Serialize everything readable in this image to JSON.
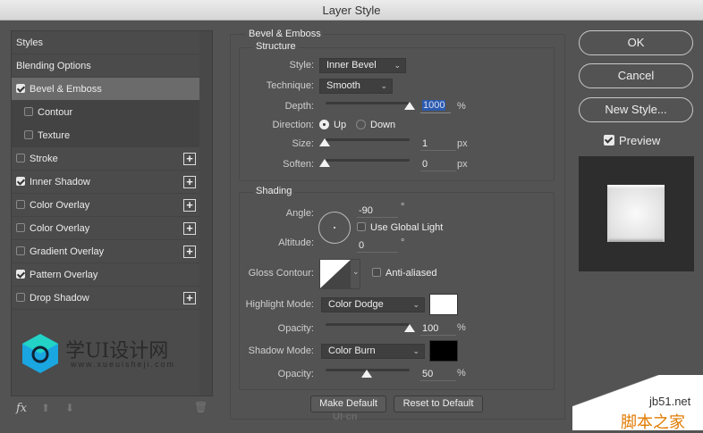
{
  "window": {
    "title": "Layer Style"
  },
  "sidebar": {
    "items": [
      {
        "label": "Styles",
        "checkbox": null
      },
      {
        "label": "Blending Options",
        "checkbox": null
      },
      {
        "label": "Bevel & Emboss",
        "checked": true,
        "selected": true
      },
      {
        "label": "Contour",
        "checked": false
      },
      {
        "label": "Texture",
        "checked": false
      },
      {
        "label": "Stroke",
        "checked": false,
        "plus": true
      },
      {
        "label": "Inner Shadow",
        "checked": true,
        "plus": true
      },
      {
        "label": "Color Overlay",
        "checked": false,
        "plus": true
      },
      {
        "label": "Color Overlay",
        "checked": false,
        "plus": true
      },
      {
        "label": "Gradient Overlay",
        "checked": false,
        "plus": true
      },
      {
        "label": "Pattern Overlay",
        "checked": true
      },
      {
        "label": "Drop Shadow",
        "checked": false,
        "plus": true
      }
    ],
    "fx_label": "fx",
    "watermark": {
      "title": "学UI设计网",
      "url": "www.xueuisheji.com"
    }
  },
  "panel": {
    "section_title": "Bevel & Emboss",
    "structure": {
      "title": "Structure",
      "style_label": "Style:",
      "style_value": "Inner Bevel",
      "technique_label": "Technique:",
      "technique_value": "Smooth",
      "depth_label": "Depth:",
      "depth_value": "1000",
      "depth_unit": "%",
      "depth_slider": 1.0,
      "direction_label": "Direction:",
      "direction_up": "Up",
      "direction_down": "Down",
      "direction_selected": "Up",
      "size_label": "Size:",
      "size_value": "1",
      "size_unit": "px",
      "size_slider": 0.0,
      "soften_label": "Soften:",
      "soften_value": "0",
      "soften_unit": "px",
      "soften_slider": 0.0
    },
    "shading": {
      "title": "Shading",
      "angle_label": "Angle:",
      "angle_value": "-90",
      "angle_unit": "°",
      "global_light_label": "Use Global Light",
      "global_light_checked": false,
      "altitude_label": "Altitude:",
      "altitude_value": "0",
      "altitude_unit": "°",
      "gloss_label": "Gloss Contour:",
      "anti_aliased_label": "Anti-aliased",
      "anti_aliased_checked": false,
      "highlight_label": "Highlight Mode:",
      "highlight_value": "Color Dodge",
      "highlight_color": "#ffffff",
      "highlight_opacity_label": "Opacity:",
      "highlight_opacity": "100",
      "highlight_opacity_unit": "%",
      "shadow_label": "Shadow Mode:",
      "shadow_value": "Color Burn",
      "shadow_color": "#000000",
      "shadow_opacity_label": "Opacity:",
      "shadow_opacity": "50",
      "shadow_opacity_unit": "%"
    },
    "make_default": "Make Default",
    "reset_default": "Reset to Default"
  },
  "right": {
    "ok": "OK",
    "cancel": "Cancel",
    "new_style": "New Style...",
    "preview_label": "Preview",
    "preview_checked": true
  },
  "watermarks": {
    "center": "UI·cn",
    "site": "jb51.net",
    "site_cn": "脚本之家"
  }
}
